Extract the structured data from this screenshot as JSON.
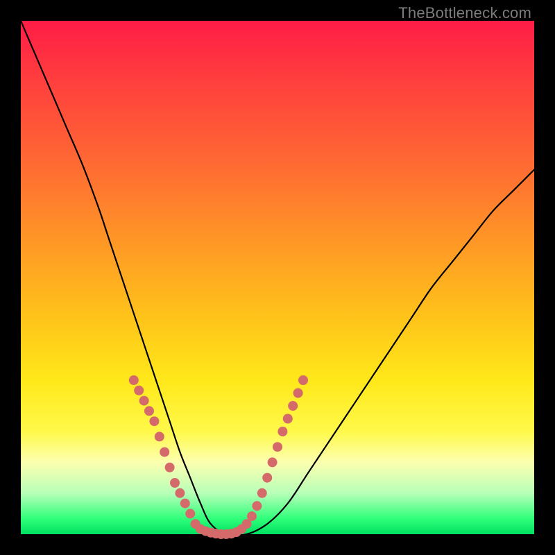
{
  "watermark": {
    "text": "TheBottleneck.com"
  },
  "chart_data": {
    "type": "line",
    "title": "",
    "xlabel": "",
    "ylabel": "",
    "xlim": [
      0,
      100
    ],
    "ylim": [
      0,
      100
    ],
    "grid": false,
    "legend": null,
    "series": [
      {
        "name": "bottleneck-curve",
        "x": [
          0,
          3,
          6,
          9,
          12,
          15,
          17,
          19,
          21,
          23,
          25,
          27,
          29,
          31,
          33,
          35,
          37,
          40,
          44,
          48,
          52,
          56,
          60,
          64,
          68,
          72,
          76,
          80,
          84,
          88,
          92,
          96,
          100
        ],
        "values": [
          100,
          93,
          86,
          79,
          72,
          64,
          58,
          52,
          46,
          40,
          34,
          28,
          22,
          16,
          11,
          6,
          2,
          0,
          0,
          2,
          6,
          12,
          18,
          24,
          30,
          36,
          42,
          48,
          53,
          58,
          63,
          67,
          71
        ]
      }
    ],
    "markers": {
      "name": "highlight-dots",
      "color": "#d46a6a",
      "x": [
        22,
        23,
        24,
        25,
        26,
        27,
        28,
        29,
        30,
        31,
        32,
        33,
        34,
        35,
        36,
        37,
        38,
        39,
        40,
        41,
        42,
        43,
        44,
        45,
        46,
        47,
        48,
        49,
        50,
        51,
        52,
        53,
        54,
        55
      ],
      "values": [
        30,
        28,
        26,
        24,
        22,
        19,
        16,
        13,
        10,
        8,
        6,
        4,
        2,
        1,
        0.6,
        0.3,
        0.1,
        0,
        0,
        0.1,
        0.4,
        1,
        2,
        3.5,
        5.5,
        8,
        11,
        14,
        17,
        20,
        22.5,
        25,
        27.5,
        30
      ]
    },
    "background_gradient": {
      "top": "#ff1c46",
      "mid": "#ffe81a",
      "bottom": "#00e060"
    }
  }
}
